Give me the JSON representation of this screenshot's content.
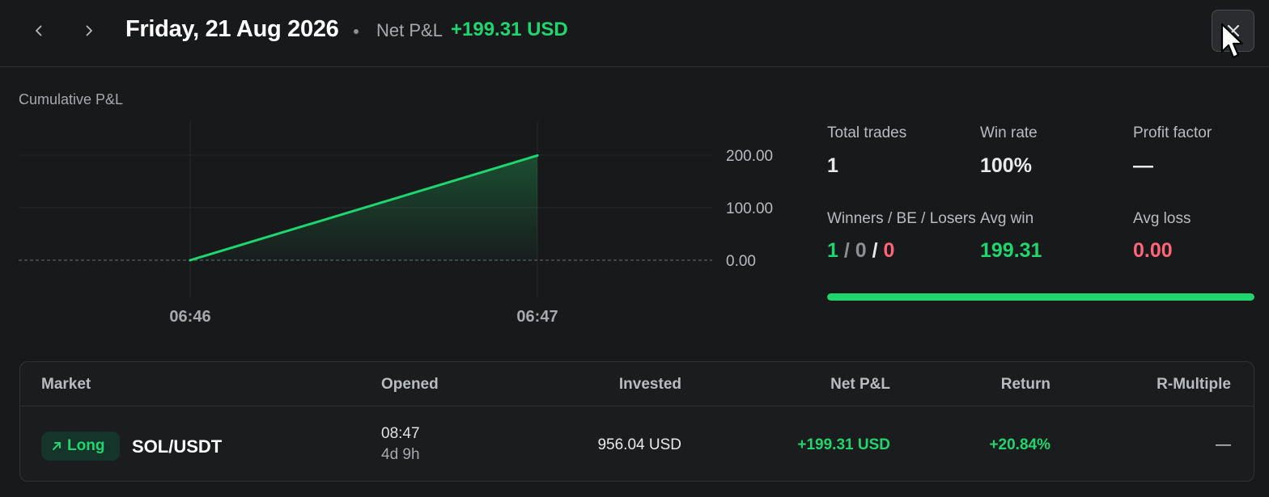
{
  "header": {
    "date_title": "Friday, 21 Aug 2026",
    "net_label": "Net P&L",
    "net_value": "+199.31 USD",
    "prev_icon": "chevron-left-icon",
    "next_icon": "chevron-right-icon",
    "close_icon": "close-icon"
  },
  "chart": {
    "label": "Cumulative P&L"
  },
  "chart_data": {
    "type": "area",
    "title": "Cumulative P&L",
    "x": [
      "06:46",
      "06:47"
    ],
    "y_ticks": [
      "200.00",
      "100.00",
      "0.00"
    ],
    "ylim": [
      0,
      200
    ],
    "series": [
      {
        "values": [
          0,
          199.31
        ]
      }
    ],
    "color": "#1fd66e",
    "grid": true
  },
  "stats": {
    "total_trades_label": "Total trades",
    "total_trades_value": "1",
    "win_rate_label": "Win rate",
    "win_rate_value": "100%",
    "profit_factor_label": "Profit factor",
    "profit_factor_value": "—",
    "wbl_label": "Winners / BE / Losers",
    "winners": "1",
    "be": "0",
    "losers": "0",
    "slash": "/",
    "avg_win_label": "Avg win",
    "avg_win_value": "199.31",
    "avg_loss_label": "Avg loss",
    "avg_loss_value": "0.00",
    "win_fraction": 1.0
  },
  "table": {
    "columns": [
      "Market",
      "Opened",
      "Invested",
      "Net P&L",
      "Return",
      "R-Multiple"
    ],
    "rows": [
      {
        "direction": "Long",
        "direction_icon": "arrow-up-right-icon",
        "market": "SOL/USDT",
        "opened_time": "08:47",
        "opened_duration": "4d 9h",
        "invested": "956.04 USD",
        "net_pnl": "+199.31 USD",
        "return": "+20.84%",
        "r_multiple": "—"
      }
    ]
  },
  "colors": {
    "accent_green": "#1fd66e",
    "loss_red": "#ff6577",
    "background": "#18191b"
  }
}
